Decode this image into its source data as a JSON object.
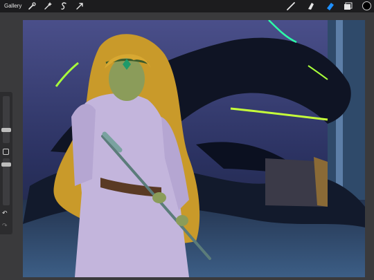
{
  "topbar": {
    "gallery_label": "Gallery",
    "left_tools": [
      {
        "name": "actions-wrench-icon"
      },
      {
        "name": "adjustments-wand-icon"
      },
      {
        "name": "selection-s-icon"
      },
      {
        "name": "transform-arrow-icon"
      }
    ],
    "right_tools": [
      {
        "name": "brush-icon",
        "active": false
      },
      {
        "name": "smudge-icon",
        "active": false
      },
      {
        "name": "eraser-icon",
        "active": true
      },
      {
        "name": "layers-icon",
        "active": false
      }
    ],
    "current_color": "#000000",
    "accent_color": "#1e90ff"
  },
  "sidebar": {
    "brush_size_label": "",
    "opacity_label": "",
    "undo_glyph": "↶",
    "redo_glyph": "↷"
  },
  "canvas": {
    "description_colors": {
      "hair": "#c99a2a",
      "dress": "#c3b5dc",
      "background": "#1b2238",
      "neon": "#a8ff3a"
    }
  }
}
